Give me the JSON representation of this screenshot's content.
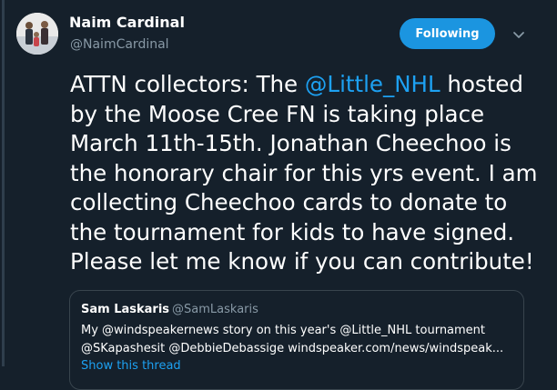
{
  "author": {
    "name": "Naim Cardinal",
    "handle": "@NaimCardinal"
  },
  "follow_button": {
    "label": "Following"
  },
  "tweet": {
    "line1_pre": "ATTN collectors: The ",
    "line1_mention": "@Little_NHL",
    "line1_post": " hosted",
    "line2": "by the Moose Cree FN is taking place",
    "line3": "March 11th-15th. Jonathan Cheechoo is",
    "line4": "the honorary chair for this yrs event. I am",
    "line5": "collecting Cheechoo cards to donate to",
    "line6": "the tournament for kids to have signed.",
    "line7": "Please let me know if you can contribute!"
  },
  "quote": {
    "name": "Sam Laskaris",
    "handle": "@SamLaskaris",
    "line1": "My @windspeakernews story on this year's @Little_NHL tournament",
    "line2": "@SKapashesit @DebbieDebassige windspeaker.com/news/windspeak...",
    "show_thread": "Show this thread"
  },
  "colors": {
    "background": "#15202b",
    "accent": "#1da1f2",
    "button": "#1b95e0",
    "secondary_text": "#8899a6"
  },
  "icons": [
    "chevron-down-icon"
  ]
}
